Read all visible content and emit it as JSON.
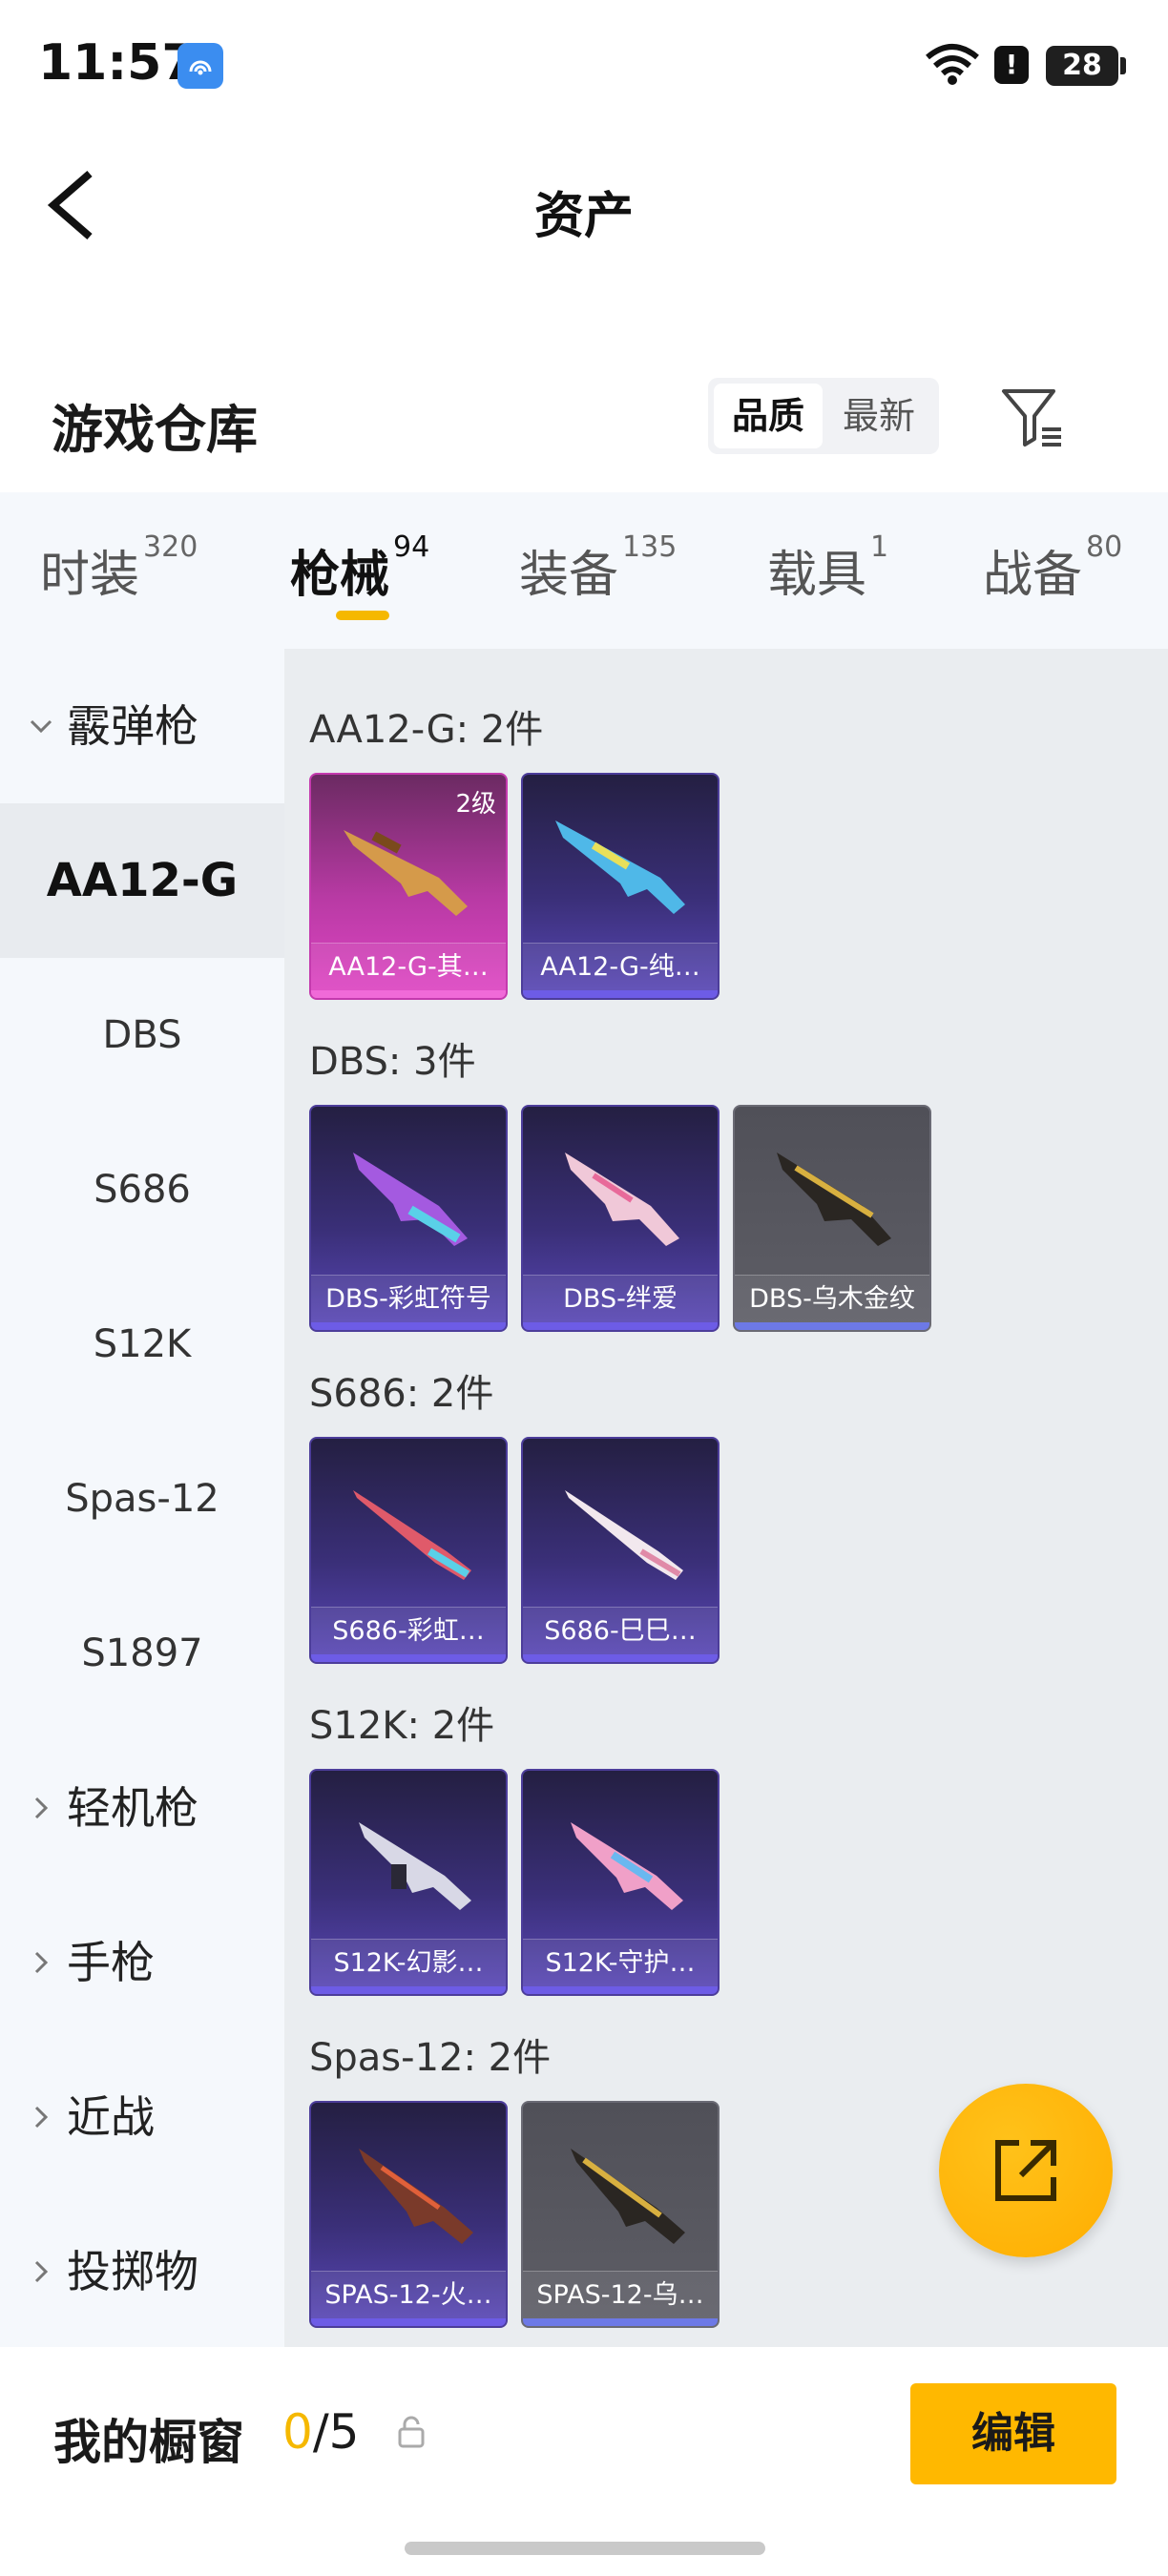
{
  "status_bar": {
    "time": "11:57",
    "battery": "28",
    "alert": "!"
  },
  "header": {
    "title": "资产"
  },
  "warehouse": {
    "title": "游戏仓库",
    "sort_options": [
      "品质",
      "最新"
    ]
  },
  "tabs": [
    {
      "label": "时装",
      "count": "320"
    },
    {
      "label": "枪械",
      "count": "94"
    },
    {
      "label": "装备",
      "count": "135"
    },
    {
      "label": "载具",
      "count": "1"
    },
    {
      "label": "战备",
      "count": "80"
    }
  ],
  "sidebar": {
    "shotgun_category": "霰弹枪",
    "items": [
      "AA12-G",
      "DBS",
      "S686",
      "S12K",
      "Spas-12",
      "S1897"
    ],
    "categories": [
      "轻机枪",
      "手枪",
      "近战",
      "投掷物"
    ]
  },
  "groups": [
    {
      "title": "AA12-G: 2件",
      "cards": [
        {
          "label": "AA12-G-其…",
          "level": "2级"
        },
        {
          "label": "AA12-G-纯…"
        }
      ]
    },
    {
      "title": "DBS: 3件",
      "cards": [
        {
          "label": "DBS-彩虹符号"
        },
        {
          "label": "DBS-绊爱"
        },
        {
          "label": "DBS-乌木金纹"
        }
      ]
    },
    {
      "title": "S686: 2件",
      "cards": [
        {
          "label": "S686-彩虹…"
        },
        {
          "label": "S686-巳巳…"
        }
      ]
    },
    {
      "title": "S12K: 2件",
      "cards": [
        {
          "label": "S12K-幻影…"
        },
        {
          "label": "S12K-守护…"
        }
      ]
    },
    {
      "title": "Spas-12: 2件",
      "cards": [
        {
          "label": "SPAS-12-火…"
        },
        {
          "label": "SPAS-12-乌…"
        }
      ]
    }
  ],
  "showcase": {
    "label": "我的橱窗",
    "current": "0",
    "total": "/5",
    "edit_label": "编辑"
  },
  "colors": {
    "accent": "#f5b800",
    "card_purple": "#3a2f78",
    "card_pink": "#e046c4",
    "card_gray": "#5e5e66"
  }
}
